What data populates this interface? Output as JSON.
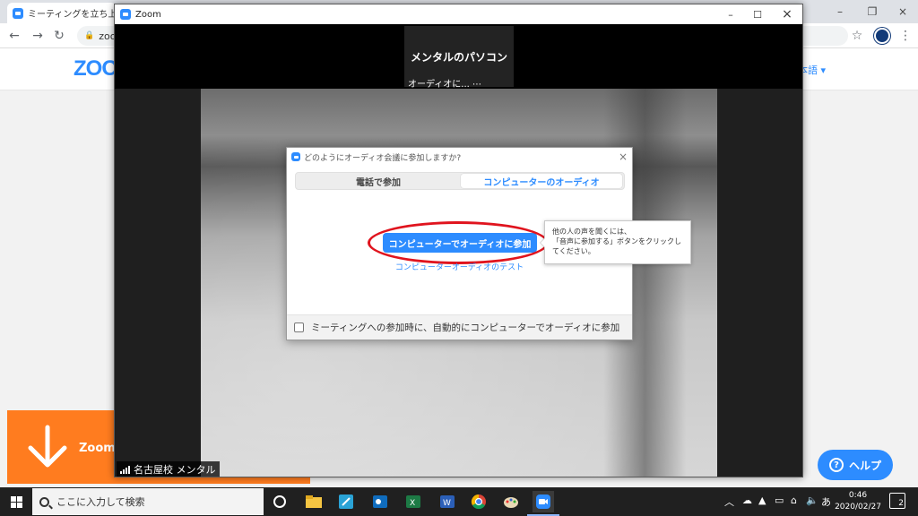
{
  "browser": {
    "tab_title": "ミーティングを立ち上げる - Z",
    "url": "zoom",
    "close_glyph": "×",
    "win_min": "–",
    "win_restore": "❐",
    "win_close": "×"
  },
  "zoom_page": {
    "logo": "ZOOM",
    "language": "本語 ▾",
    "download_text": "Zoom .",
    "help_button": "ヘルプ",
    "help_glyph": "?"
  },
  "zoom_window": {
    "title": "Zoom",
    "minimize": "–",
    "maximize": "☐",
    "close": "×",
    "thumbnail_name": "メンタルのパソコン",
    "thumbnail_audio": "オーディオに...  ⋯",
    "participant_label": "名古屋校 メンタル"
  },
  "audio_dialog": {
    "title": "どのようにオーディオ会議に参加しますか?",
    "close": "×",
    "tabs": [
      {
        "label": "電話で参加"
      },
      {
        "label": "コンピューターのオーディオ"
      }
    ],
    "join_button": "コンピューターでオーディオに参加",
    "test_link": "コンピューターオーディオのテスト",
    "auto_join_label": "ミーティングへの参加時に、自動的にコンピューターでオーディオに参加"
  },
  "tooltip": {
    "line1": "他の人の声を聞くには、",
    "line2": "「音声に参加する」ボタンをクリックし",
    "line3": "てください。"
  },
  "taskbar": {
    "search_placeholder": "ここに入力して検索",
    "time": "0:46",
    "date": "2020/02/27",
    "ime": "あ",
    "notifications": "2"
  },
  "colors": {
    "zoom_blue": "#2d8cff",
    "highlight_red": "#e0141e",
    "download_orange": "#ff7c1f"
  }
}
